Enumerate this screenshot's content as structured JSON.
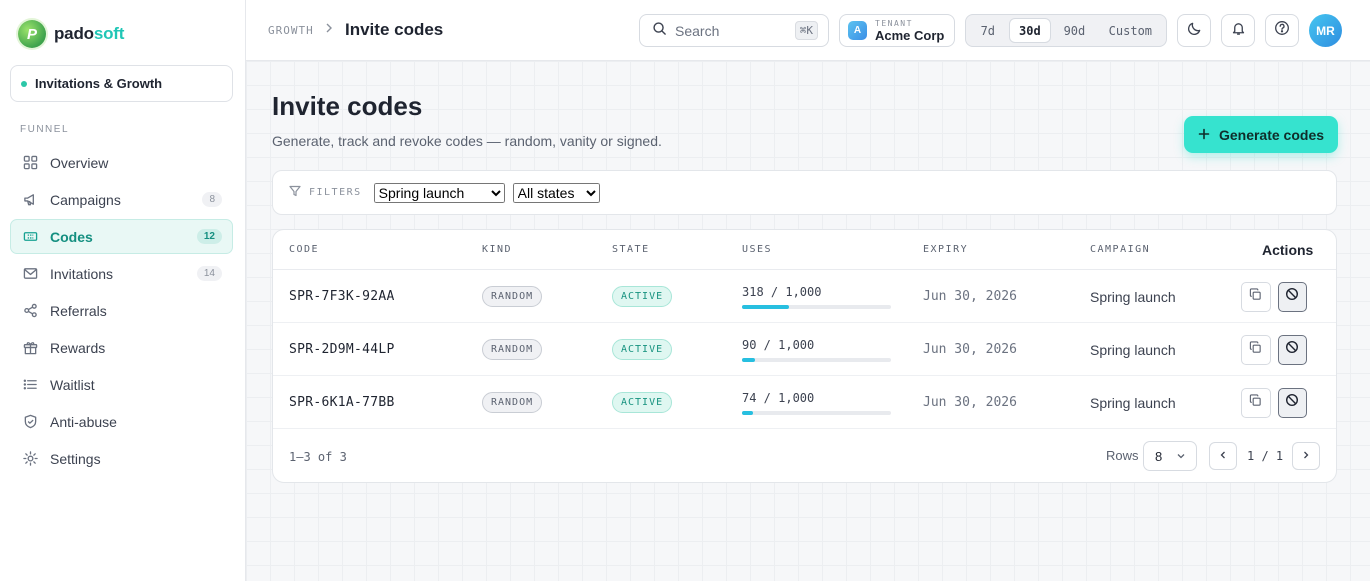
{
  "brand": {
    "name_main": "pado",
    "name_accent": "soft",
    "logo_letter": "P"
  },
  "workspace": {
    "name": "Invitations & Growth"
  },
  "sidebar": {
    "section_label": "FUNNEL",
    "items": [
      {
        "label": "Overview",
        "icon": "grid-icon",
        "count": null,
        "active": false
      },
      {
        "label": "Campaigns",
        "icon": "megaphone-icon",
        "count": "8",
        "active": false
      },
      {
        "label": "Codes",
        "icon": "ticket-icon",
        "count": "12",
        "active": true
      },
      {
        "label": "Invitations",
        "icon": "mail-icon",
        "count": "14",
        "active": false
      },
      {
        "label": "Referrals",
        "icon": "share-icon",
        "count": null,
        "active": false
      },
      {
        "label": "Rewards",
        "icon": "gift-icon",
        "count": null,
        "active": false
      },
      {
        "label": "Waitlist",
        "icon": "list-icon",
        "count": null,
        "active": false
      },
      {
        "label": "Anti-abuse",
        "icon": "shield-icon",
        "count": null,
        "active": false
      },
      {
        "label": "Settings",
        "icon": "gear-icon",
        "count": null,
        "active": false
      }
    ]
  },
  "topbar": {
    "breadcrumb_root": "GROWTH",
    "breadcrumb_current": "Invite codes",
    "search_placeholder": "Search",
    "search_shortcut": "⌘K",
    "tenant_label": "TENANT",
    "tenant_name": "Acme Corp",
    "tenant_initial": "A",
    "ranges": [
      "7d",
      "30d",
      "90d",
      "Custom"
    ],
    "range_selected": "30d",
    "user_initials": "MR"
  },
  "page": {
    "title": "Invite codes",
    "subtitle": "Generate, track and revoke codes — random, vanity or signed.",
    "generate_button": "Generate codes"
  },
  "filters": {
    "label": "FILTERS",
    "campaign_selected": "Spring launch",
    "state_selected": "All states"
  },
  "table": {
    "headers": {
      "code": "CODE",
      "kind": "KIND",
      "state": "STATE",
      "uses": "USES",
      "expiry": "EXPIRY",
      "campaign": "CAMPAIGN",
      "actions": "Actions"
    },
    "rows": [
      {
        "code": "SPR-7F3K-92AA",
        "kind": "RANDOM",
        "state": "ACTIVE",
        "uses": "318 / 1,000",
        "uses_fraction": 0.318,
        "expiry": "Jun 30, 2026",
        "campaign": "Spring launch"
      },
      {
        "code": "SPR-2D9M-44LP",
        "kind": "RANDOM",
        "state": "ACTIVE",
        "uses": "90 / 1,000",
        "uses_fraction": 0.09,
        "expiry": "Jun 30, 2026",
        "campaign": "Spring launch"
      },
      {
        "code": "SPR-6K1A-77BB",
        "kind": "RANDOM",
        "state": "ACTIVE",
        "uses": "74 / 1,000",
        "uses_fraction": 0.074,
        "expiry": "Jun 30, 2026",
        "campaign": "Spring launch"
      }
    ],
    "count_label": "1–3 of 3",
    "rows_label": "Rows",
    "rows_per_page": "8",
    "page_indicator": "1 / 1"
  },
  "colors": {
    "accent": "#36e3cf",
    "active_nav": "#148f80",
    "bar": "#27bfe0"
  }
}
